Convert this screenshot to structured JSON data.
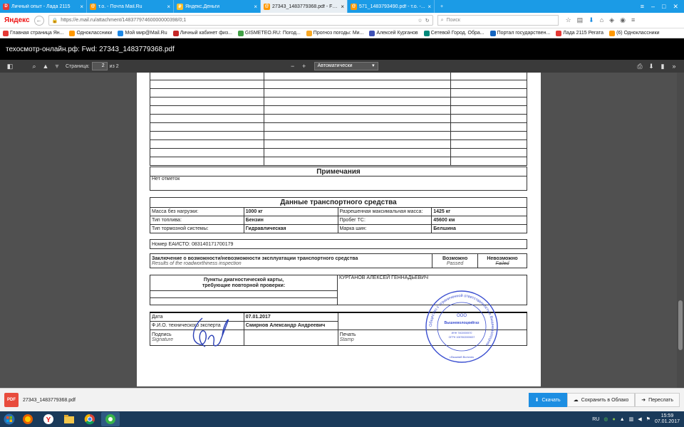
{
  "tabs": [
    {
      "title": "Личный опыт - Лада 2115",
      "favicon": "drive-icon",
      "color": "#e53935"
    },
    {
      "title": "т.о. - Почта Mail.Ru",
      "favicon": "mail-icon",
      "color": "#ff9800"
    },
    {
      "title": "Яндекс.Деньги",
      "favicon": "wallet-icon",
      "color": "#fbc02d"
    },
    {
      "title": "27343_1483779368.pdf - Fw...",
      "favicon": "mail-icon",
      "color": "#ff9800",
      "active": true
    },
    {
      "title": "571_1483793490.pdf - т.о. -...",
      "favicon": "mail-icon",
      "color": "#ff9800"
    }
  ],
  "browser": {
    "logo": "Яндекс",
    "url": "https://e.mail.ru/attachment/14837797460000000398/0;1",
    "search_placeholder": "Поиск"
  },
  "bookmarks": [
    {
      "label": "Главная страница Ян...",
      "color": "#e53935"
    },
    {
      "label": "Одноклассники",
      "color": "#ff9800"
    },
    {
      "label": "Мой мир@Mail.Ru",
      "color": "#1e88e5"
    },
    {
      "label": "Личный кабинет физ...",
      "color": "#c62828"
    },
    {
      "label": "GISMETEO.RU: Погод...",
      "color": "#43a047"
    },
    {
      "label": "Прогноз погоды: Ми...",
      "color": "#f9a825"
    },
    {
      "label": "Алексей Курганов",
      "color": "#3f51b5"
    },
    {
      "label": "Сетевой Город. Обра...",
      "color": "#00897b"
    },
    {
      "label": "Портал государствен...",
      "color": "#1565c0"
    },
    {
      "label": "Лада 2115 Регата",
      "color": "#e53935"
    },
    {
      "label": "(6) Одноклассники",
      "color": "#ff9800"
    }
  ],
  "window_title": "техосмотр-онлайн.рф: Fwd: 27343_1483779368.pdf",
  "pdf_toolbar": {
    "page_label": "Страница:",
    "page_number": "2",
    "page_total": "из 2",
    "zoom": "Автоматически"
  },
  "doc": {
    "notes_title": "Примечания",
    "notes_text": "Нет отметок",
    "vehicle_title": "Данные транспортного средства",
    "vehicle_rows": [
      [
        "Масса без нагрузки:",
        "1000 кг",
        "Разрешенная максимальная масса:",
        "1425 кг"
      ],
      [
        "Тип топлива:",
        "Бензин",
        "Пробег ТС:",
        "45600 км"
      ],
      [
        "Тип тормозной системы:",
        "Гидравлическая",
        "Марка шин:",
        "Белшина"
      ]
    ],
    "eaisto": "Номер ЕАИСТО: 083140171700179",
    "conclusion_ru": "Заключение о возможности/невозможности эксплуатации транспортного средства",
    "conclusion_en": "Results of the roadworthiness inspection",
    "possible_ru": "Возможно",
    "possible_en": "Passed",
    "impossible_ru": "Невозможно",
    "impossible_en": "Failed",
    "recheck_line1": "Пункты диагностической карты,",
    "recheck_line2": "требующие повторной проверки:",
    "expert_name_top": "КУРГАНОВ АЛЕКСЕЙ ГЕННАДЬЕВИЧ",
    "date_label": "Дата",
    "date_value": "07.01.2017",
    "fio_label": "Ф.И.О. технического эксперта",
    "fio_value": "Смирнов Александр Андреевич",
    "sign_label": "Подпись",
    "sign_en": "Signature",
    "stamp_label": "Печать",
    "stamp_en": "Stamp",
    "stamp_text": "Общество с ограниченной ответственностью Вышневолоцкий",
    "stamp_center": "ООО",
    "stamp_name": "Вышневолоцкийгаз",
    "stamp_inn": "ИНН 7402000570",
    "stamp_ogrn": "ОГРН 1067602000637",
    "stamp_city": "г.Вышний Волочек"
  },
  "download": {
    "file_icon": "PDF",
    "filename": "27343_1483779368.pdf",
    "download_label": "Скачать",
    "save_cloud_label": "Сохранить в Облако",
    "forward_label": "Переслать"
  },
  "tray": {
    "lang": "RU",
    "time": "15:59",
    "date": "07.01.2017"
  }
}
